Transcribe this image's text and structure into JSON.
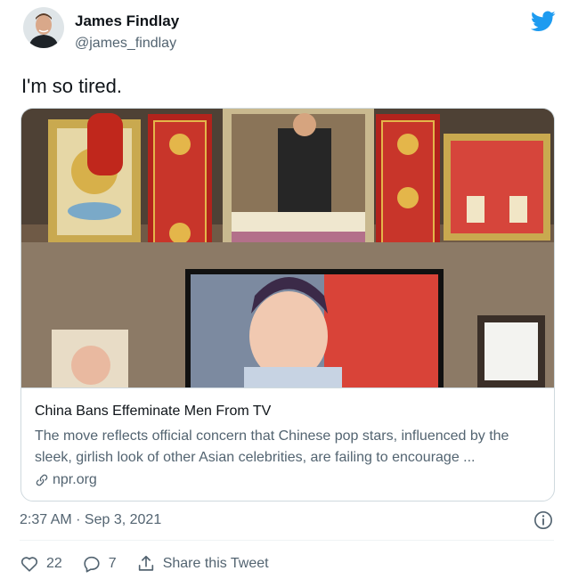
{
  "author": {
    "name": "James Findlay",
    "handle": "@james_findlay",
    "avatar_icon": "person-avatar-icon"
  },
  "brand": {
    "icon": "twitter-bird-icon",
    "color": "#1d9bf0"
  },
  "tweet": {
    "text": "I'm so tired."
  },
  "card": {
    "image_icon": "news-photo",
    "title": "China Bans Effeminate Men From TV",
    "description": "The move reflects official concern that Chinese pop stars, influenced by the sleek, girlish look of other Asian celebrities, are failing to encourage ...",
    "domain": "npr.org",
    "domain_icon": "link-icon"
  },
  "meta": {
    "timestamp": "2:37 AM · Sep 3, 2021",
    "info_icon": "info-icon"
  },
  "actions": {
    "likes": "22",
    "replies": "7",
    "share_label": "Share this Tweet",
    "like_icon": "heart-icon",
    "reply_icon": "reply-icon",
    "share_icon": "share-icon"
  },
  "colors": {
    "text": "#0f1419",
    "secondary": "#536471",
    "border": "#cfd9de"
  }
}
